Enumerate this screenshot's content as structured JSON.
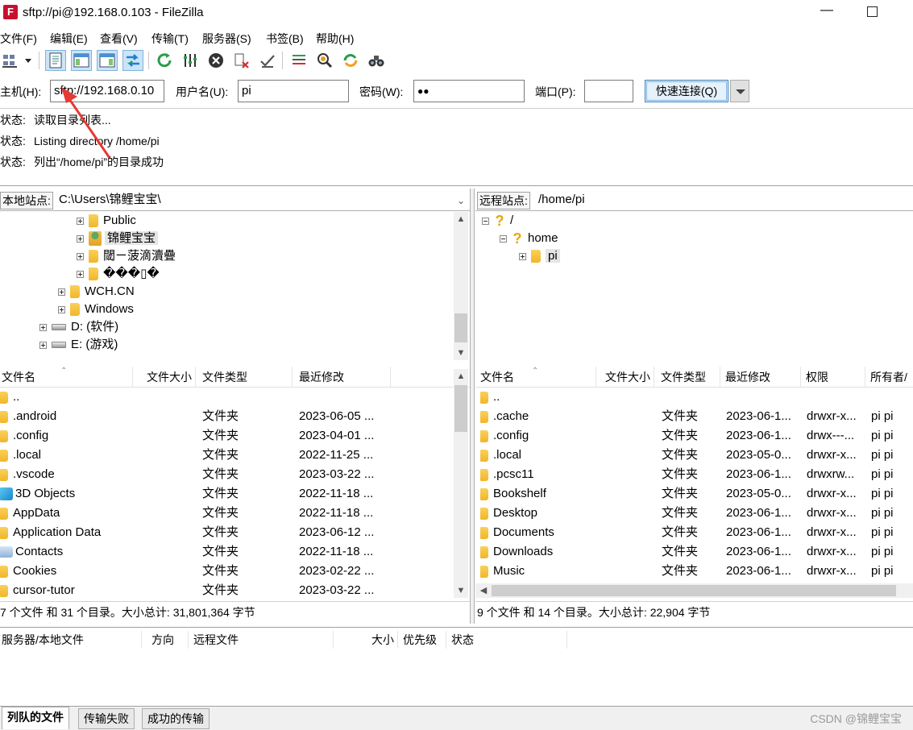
{
  "window": {
    "title": "sftp://pi@192.168.0.103 - FileZilla",
    "app_icon_glyph": "F",
    "minimize_glyph": "—"
  },
  "menu": [
    "文件(F)",
    "编辑(E)",
    "查看(V)",
    "传输(T)",
    "服务器(S)",
    "书签(B)",
    "帮助(H)"
  ],
  "toolbar_icons": [
    "site-manager-icon",
    "site-manager-dropdown-icon",
    "message-log-icon",
    "local-tree-icon",
    "remote-tree-icon",
    "transfer-queue-icon",
    "refresh-icon",
    "process-queue-icon",
    "cancel-icon",
    "disconnect-icon",
    "reconnect-icon",
    "filter-icon",
    "toggle-filter-icon",
    "sync-browse-icon",
    "search-icon"
  ],
  "quickconnect": {
    "host_label": "主机(H):",
    "host_value": "sftp://192.168.0.10",
    "user_label": "用户名(U):",
    "user_value": "pi",
    "pass_label": "密码(W):",
    "pass_value": "●●",
    "port_label": "端口(P):",
    "port_value": "",
    "connect_button": "快速连接(Q)"
  },
  "log": [
    {
      "label": "状态:",
      "text": "读取目录列表..."
    },
    {
      "label": "状态:",
      "text": "Listing directory /home/pi"
    },
    {
      "label": "状态:",
      "text": "列出“/home/pi”的目录成功"
    }
  ],
  "local": {
    "site_label": "本地站点:",
    "site_path": "C:\\Users\\锦鲤宝宝\\",
    "tree": [
      {
        "name": "Public",
        "icon": "folder",
        "indent": 3
      },
      {
        "name": "锦鲤宝宝",
        "icon": "user-folder",
        "indent": 3
      },
      {
        "name": "閾ㄧ菠滴瀆疊",
        "icon": "folder",
        "indent": 3
      },
      {
        "name": "���▯�",
        "icon": "folder",
        "indent": 3
      },
      {
        "name": "WCH.CN",
        "icon": "folder",
        "indent": 2
      },
      {
        "name": "Windows",
        "icon": "folder",
        "indent": 2
      },
      {
        "name": "D: (软件)",
        "icon": "drive",
        "indent": 1
      },
      {
        "name": "E: (游戏)",
        "icon": "drive",
        "indent": 1
      }
    ],
    "columns": [
      "文件名",
      "文件大小",
      "文件类型",
      "最近修改"
    ],
    "rows": [
      {
        "name": "..",
        "type": "",
        "date": "",
        "icon": "folder"
      },
      {
        "name": ".android",
        "type": "文件夹",
        "date": "2023-06-05 ...",
        "icon": "folder"
      },
      {
        "name": ".config",
        "type": "文件夹",
        "date": "2023-04-01 ...",
        "icon": "folder"
      },
      {
        "name": ".local",
        "type": "文件夹",
        "date": "2022-11-25 ...",
        "icon": "folder"
      },
      {
        "name": ".vscode",
        "type": "文件夹",
        "date": "2023-03-22 ...",
        "icon": "folder"
      },
      {
        "name": "3D Objects",
        "type": "文件夹",
        "date": "2022-11-18 ...",
        "icon": "objects"
      },
      {
        "name": "AppData",
        "type": "文件夹",
        "date": "2022-11-18 ...",
        "icon": "folder"
      },
      {
        "name": "Application Data",
        "type": "文件夹",
        "date": "2023-06-12 ...",
        "icon": "folder"
      },
      {
        "name": "Contacts",
        "type": "文件夹",
        "date": "2022-11-18 ...",
        "icon": "contacts"
      },
      {
        "name": "Cookies",
        "type": "文件夹",
        "date": "2023-02-22 ...",
        "icon": "folder"
      },
      {
        "name": "cursor-tutor",
        "type": "文件夹",
        "date": "2023-03-22 ...",
        "icon": "folder"
      }
    ],
    "status": "7 个文件 和 31 个目录。大小总计: 31,801,364 字节"
  },
  "remote": {
    "site_label": "远程站点:",
    "site_path": "/home/pi",
    "tree": [
      {
        "name": "/",
        "icon": "question",
        "indent": 0
      },
      {
        "name": "home",
        "icon": "question",
        "indent": 1
      },
      {
        "name": "pi",
        "icon": "folder",
        "indent": 2
      }
    ],
    "columns": [
      "文件名",
      "文件大小",
      "文件类型",
      "最近修改",
      "权限",
      "所有者/"
    ],
    "rows": [
      {
        "name": "..",
        "type": "",
        "date": "",
        "perm": "",
        "owner": ""
      },
      {
        "name": ".cache",
        "type": "文件夹",
        "date": "2023-06-1...",
        "perm": "drwxr-x...",
        "owner": "pi pi"
      },
      {
        "name": ".config",
        "type": "文件夹",
        "date": "2023-06-1...",
        "perm": "drwx---...",
        "owner": "pi pi"
      },
      {
        "name": ".local",
        "type": "文件夹",
        "date": "2023-05-0...",
        "perm": "drwxr-x...",
        "owner": "pi pi"
      },
      {
        "name": ".pcsc11",
        "type": "文件夹",
        "date": "2023-06-1...",
        "perm": "drwxrw...",
        "owner": "pi pi"
      },
      {
        "name": "Bookshelf",
        "type": "文件夹",
        "date": "2023-05-0...",
        "perm": "drwxr-x...",
        "owner": "pi pi"
      },
      {
        "name": "Desktop",
        "type": "文件夹",
        "date": "2023-06-1...",
        "perm": "drwxr-x...",
        "owner": "pi pi"
      },
      {
        "name": "Documents",
        "type": "文件夹",
        "date": "2023-06-1...",
        "perm": "drwxr-x...",
        "owner": "pi pi"
      },
      {
        "name": "Downloads",
        "type": "文件夹",
        "date": "2023-06-1...",
        "perm": "drwxr-x...",
        "owner": "pi pi"
      },
      {
        "name": "Music",
        "type": "文件夹",
        "date": "2023-06-1...",
        "perm": "drwxr-x...",
        "owner": "pi pi"
      }
    ],
    "status": "9 个文件 和 14 个目录。大小总计: 22,904 字节"
  },
  "queue": {
    "columns": [
      "服务器/本地文件",
      "方向",
      "远程文件",
      "大小",
      "优先级",
      "状态"
    ]
  },
  "tabs": [
    "列队的文件",
    "传输失败",
    "成功的传输"
  ],
  "watermark": "CSDN @锦鲤宝宝",
  "colors": {
    "accent": "#cce4f7",
    "folder": "#f2b529",
    "annotation_arrow": "#e53935"
  }
}
